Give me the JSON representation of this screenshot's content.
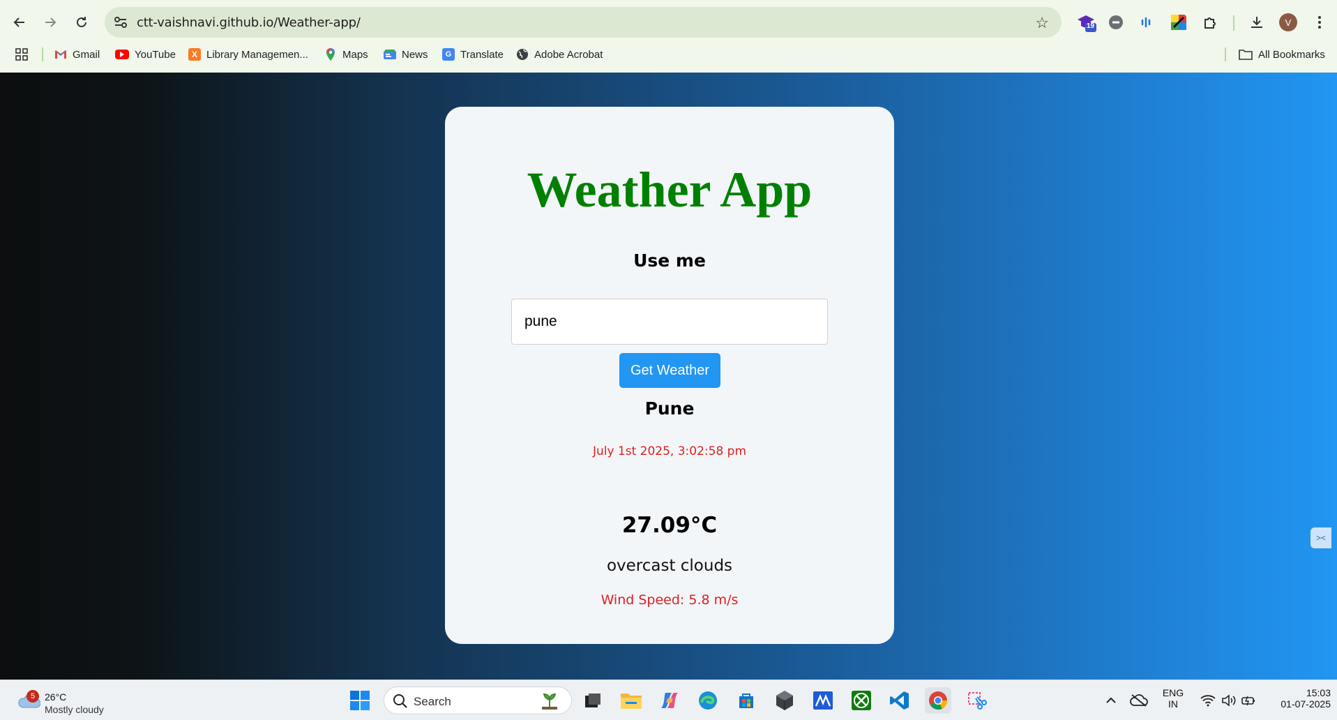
{
  "browser": {
    "url": "ctt-vaishnavi.github.io/Weather-app/",
    "profile_initial": "V",
    "extension_badge": "19",
    "bookmarks": [
      {
        "label": "Gmail",
        "icon": "gmail-icon"
      },
      {
        "label": "YouTube",
        "icon": "youtube-icon"
      },
      {
        "label": "Library Managemen...",
        "icon": "xampp-icon"
      },
      {
        "label": "Maps",
        "icon": "maps-icon"
      },
      {
        "label": "News",
        "icon": "news-icon"
      },
      {
        "label": "Translate",
        "icon": "translate-icon"
      },
      {
        "label": "Adobe Acrobat",
        "icon": "globe-icon"
      }
    ],
    "all_bookmarks": "All Bookmarks"
  },
  "app": {
    "title": "Weather App",
    "subtitle": "Use me",
    "input_value": "pune",
    "button_label": "Get Weather",
    "city": "Pune",
    "datetime": "July 1st 2025, 3:02:58 pm",
    "temperature": "27.09°C",
    "description": "overcast clouds",
    "wind": "Wind Speed: 5.8 m/s"
  },
  "taskbar": {
    "weather_badge": "5",
    "weather_temp": "26°C",
    "weather_desc": "Mostly cloudy",
    "search_label": "Search",
    "lang_line1": "ENG",
    "lang_line2": "IN",
    "time": "15:03",
    "date": "01-07-2025"
  },
  "colors": {
    "title_green": "#008000",
    "accent_blue": "#2196f3",
    "alert_red": "#e01e1e"
  }
}
